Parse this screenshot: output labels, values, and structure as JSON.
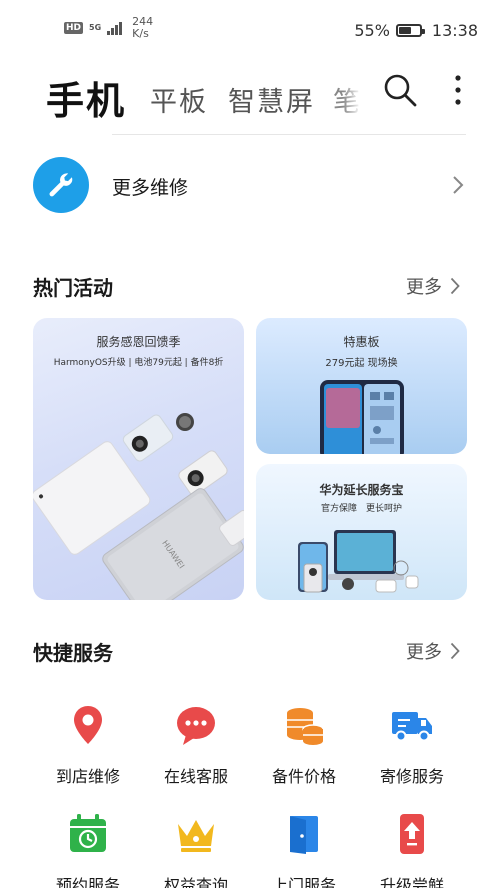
{
  "status_bar": {
    "hd": "HD",
    "network": "5G",
    "speed_value": "244",
    "speed_unit": "K/s",
    "battery_percent": "55%",
    "battery_level": 0.55,
    "time": "13:38"
  },
  "tabs": {
    "active": "手机",
    "items": [
      "平板",
      "智慧屏"
    ],
    "partial": "笔"
  },
  "repair": {
    "label": "更多维修"
  },
  "hot_activities": {
    "title": "热门活动",
    "more": "更多",
    "cards": [
      {
        "title": "服务感恩回馈季",
        "subtitle": "HarmonyOS升级 | 电池79元起 | 备件8折"
      },
      {
        "title": "特惠板",
        "subtitle": "279元起 现场换"
      },
      {
        "title": "华为延长服务宝",
        "subtitle": "官方保障　更长呵护"
      }
    ],
    "laptop_brand": "HUAWEI"
  },
  "quick_services": {
    "title": "快捷服务",
    "more": "更多",
    "items": [
      {
        "label": "到店维修",
        "icon": "location-pin-icon",
        "color": "#e84a4a"
      },
      {
        "label": "在线客服",
        "icon": "chat-bubble-icon",
        "color": "#e84a4a"
      },
      {
        "label": "备件价格",
        "icon": "coins-icon",
        "color": "#f08a2a"
      },
      {
        "label": "寄修服务",
        "icon": "truck-icon",
        "color": "#2b86e8"
      },
      {
        "label": "预约服务",
        "icon": "calendar-icon",
        "color": "#2fb24a"
      },
      {
        "label": "权益查询",
        "icon": "crown-icon",
        "color": "#f2b81e"
      },
      {
        "label": "上门服务",
        "icon": "door-icon",
        "color": "#2b86e8"
      },
      {
        "label": "升级尝鲜",
        "icon": "upgrade-phone-icon",
        "color": "#e84a4a"
      }
    ]
  },
  "colors": {
    "accent": "#1e9fe8",
    "red": "#e84a4a",
    "orange": "#f08a2a",
    "blue": "#2b86e8",
    "green": "#2fb24a",
    "gold": "#f2b81e"
  }
}
